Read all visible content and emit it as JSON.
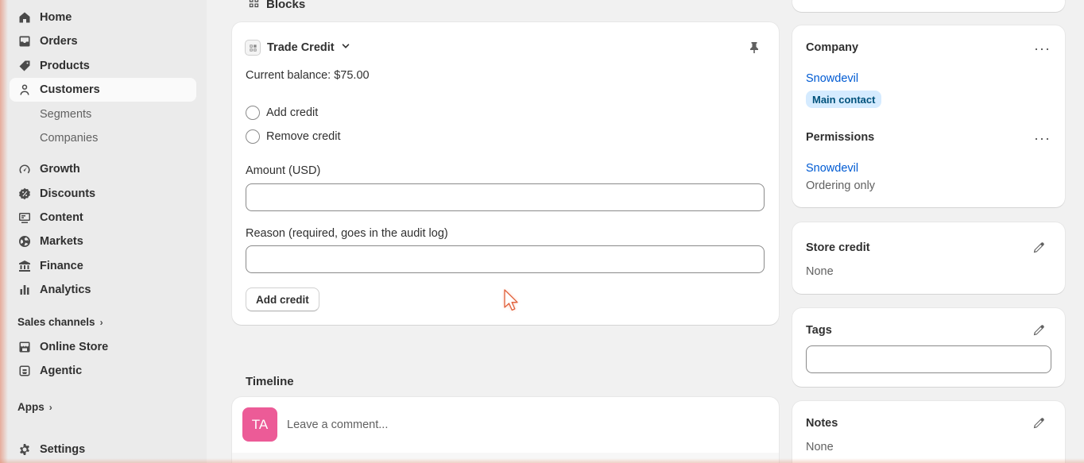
{
  "sidebar": {
    "items": [
      {
        "label": "Home",
        "icon": "home-icon"
      },
      {
        "label": "Orders",
        "icon": "inbox-icon"
      },
      {
        "label": "Products",
        "icon": "tag-icon"
      },
      {
        "label": "Customers",
        "icon": "person-icon"
      },
      {
        "label": "Growth",
        "icon": "gauge-icon"
      },
      {
        "label": "Discounts",
        "icon": "discount-icon"
      },
      {
        "label": "Content",
        "icon": "content-icon"
      },
      {
        "label": "Markets",
        "icon": "globe-icon"
      },
      {
        "label": "Finance",
        "icon": "bank-icon"
      },
      {
        "label": "Analytics",
        "icon": "bar-chart-icon"
      }
    ],
    "customers_sub": [
      "Segments",
      "Companies"
    ],
    "sales_channels_label": "Sales channels",
    "channels": [
      {
        "label": "Online Store",
        "icon": "storefront-icon"
      },
      {
        "label": "Agentic",
        "icon": "agent-icon"
      }
    ],
    "apps_label": "Apps",
    "settings_label": "Settings"
  },
  "main": {
    "blocks_heading": "Blocks",
    "trade_credit": {
      "title": "Trade Credit",
      "balance": "Current balance: $75.00",
      "options": [
        "Add credit",
        "Remove credit"
      ],
      "amount_label": "Amount (USD)",
      "amount_value": "",
      "reason_label": "Reason (required, goes in the audit log)",
      "reason_value": "",
      "submit_label": "Add credit"
    },
    "timeline": {
      "heading": "Timeline",
      "avatar_initials": "TA",
      "comment_placeholder": "Leave a comment..."
    }
  },
  "right": {
    "company": {
      "title": "Company",
      "name": "Snowdevil",
      "badge": "Main contact"
    },
    "permissions": {
      "title": "Permissions",
      "name": "Snowdevil",
      "level": "Ordering only"
    },
    "store_credit": {
      "title": "Store credit",
      "value": "None"
    },
    "tags": {
      "title": "Tags",
      "value": ""
    },
    "notes": {
      "title": "Notes",
      "value": "None"
    }
  },
  "colors": {
    "accent_link": "#005bd3",
    "badge_bg": "#d5ebff",
    "avatar_bg": "#ec5b97",
    "sidebar_bg": "#ebebeb",
    "page_bg": "#f1f1f1"
  }
}
